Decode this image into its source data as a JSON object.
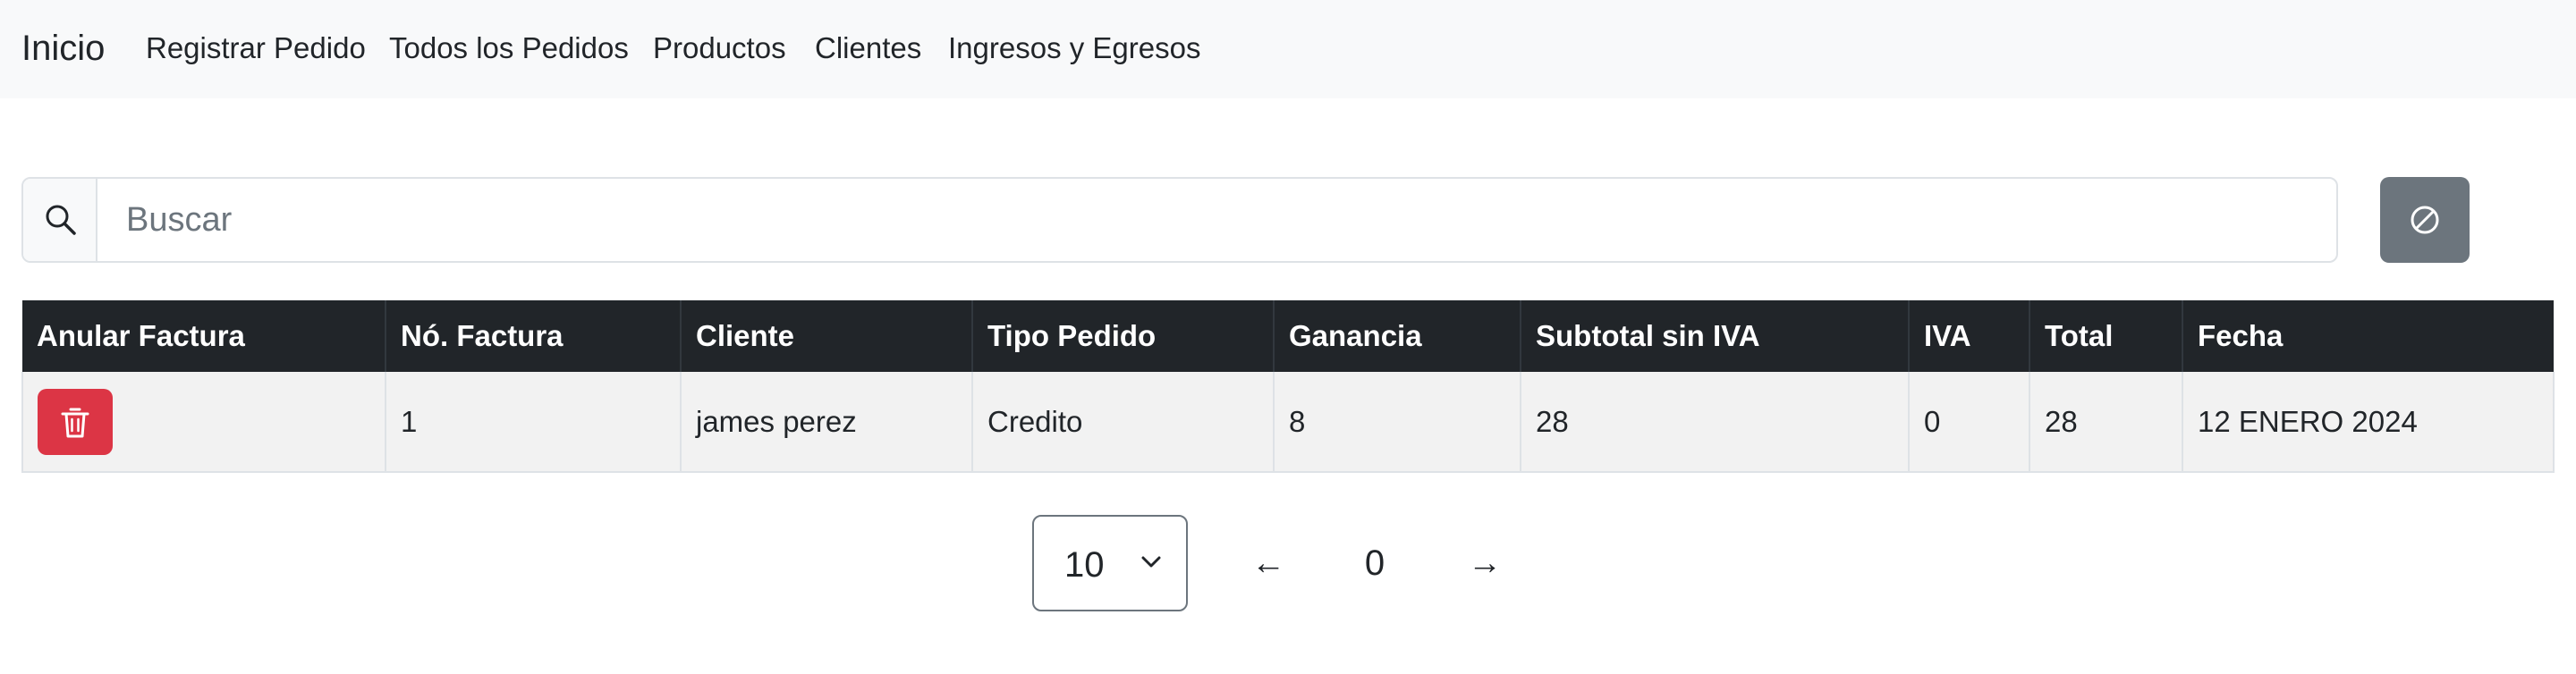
{
  "navbar": {
    "brand": "Inicio",
    "links": [
      "Registrar Pedido",
      "Todos los Pedidos",
      "Productos",
      "Clientes",
      "Ingresos y Egresos"
    ]
  },
  "search": {
    "placeholder": "Buscar",
    "value": "",
    "icon": "search-icon"
  },
  "clear_button": {
    "icon": "ban-icon",
    "color": "#6c757d"
  },
  "table": {
    "headers": [
      "Anular Factura",
      "Nó. Factura",
      "Cliente",
      "Tipo Pedido",
      "Ganancia",
      "Subtotal sin IVA",
      "IVA",
      "Total",
      "Fecha"
    ],
    "rows": [
      {
        "delete_icon": "trash-icon",
        "invoice": "1",
        "client": "james perez",
        "order_type": "Credito",
        "profit": "8",
        "subtotal": "28",
        "iva": "0",
        "total": "28",
        "date": "12 ENERO 2024"
      }
    ]
  },
  "pagination": {
    "page_size": "10",
    "page_number": "0",
    "prev": "←",
    "next": "→"
  },
  "colors": {
    "navbar_bg": "#f8f9fa",
    "table_header_bg": "#212529",
    "danger": "#dc3545",
    "secondary": "#6c757d"
  }
}
